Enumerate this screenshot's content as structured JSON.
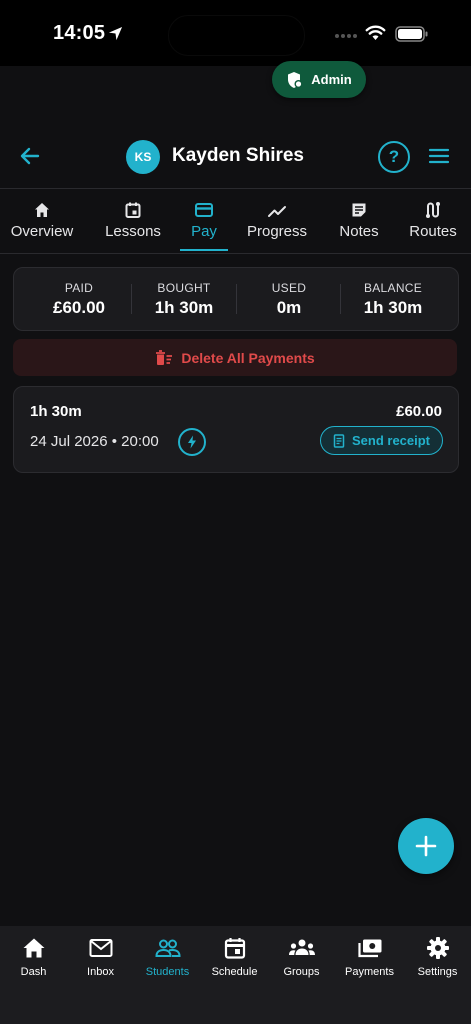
{
  "status_bar": {
    "time": "14:05"
  },
  "admin": {
    "label": "Admin"
  },
  "header": {
    "avatar_initials": "KS",
    "student_name": "Kayden Shires",
    "help_label": "?"
  },
  "tabs": [
    {
      "label": "Overview",
      "icon": "home-icon",
      "active": false
    },
    {
      "label": "Lessons",
      "icon": "calendar-icon",
      "active": false
    },
    {
      "label": "Pay",
      "icon": "card-icon",
      "active": true
    },
    {
      "label": "Progress",
      "icon": "trend-icon",
      "active": false
    },
    {
      "label": "Notes",
      "icon": "note-icon",
      "active": false
    },
    {
      "label": "Routes",
      "icon": "route-icon",
      "active": false
    }
  ],
  "summary": {
    "paid_label": "PAID",
    "paid_value": "£60.00",
    "bought_label": "BOUGHT",
    "bought_value": "1h 30m",
    "used_label": "USED",
    "used_value": "0m",
    "balance_label": "BALANCE",
    "balance_value": "1h 30m"
  },
  "delete_all": {
    "label": "Delete All Payments"
  },
  "payments": [
    {
      "duration": "1h 30m",
      "amount": "£60.00",
      "datetime": "24 Jul 2026 • 20:00",
      "receipt_label": "Send receipt"
    }
  ],
  "bottom_nav": [
    {
      "label": "Dash",
      "icon": "home-icon",
      "active": false
    },
    {
      "label": "Inbox",
      "icon": "mail-icon",
      "active": false
    },
    {
      "label": "Students",
      "icon": "people-icon",
      "active": true
    },
    {
      "label": "Schedule",
      "icon": "calendar-icon",
      "active": false
    },
    {
      "label": "Groups",
      "icon": "groups-icon",
      "active": false
    },
    {
      "label": "Payments",
      "icon": "payments-icon",
      "active": false
    },
    {
      "label": "Settings",
      "icon": "gear-icon",
      "active": false
    }
  ],
  "colors": {
    "accent": "#22b2cc",
    "danger": "#e04a4a",
    "admin": "#0f5a3c",
    "background": "#101012"
  }
}
